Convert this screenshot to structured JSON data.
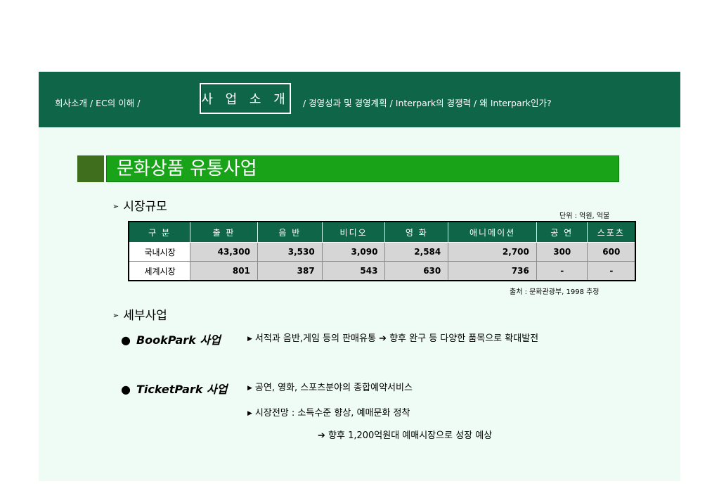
{
  "nav": {
    "left": "회사소개  /  EC의 이해  /",
    "active": "사 업 소 개",
    "right": "/ 경영성과 및  경영계획  /  Interpark의  경쟁력  /  왜 Interpark인가?"
  },
  "title": "문화상품 유통사업",
  "market": {
    "heading": "시장규모",
    "unit": "단위 : 억원, 억불",
    "source": "출처 : 문화관광부, 1998 추정",
    "headers": [
      "구  분",
      "출  판",
      "음  반",
      "비디오",
      "영  화",
      "애니메이션",
      "공  연",
      "스포츠"
    ],
    "rows": [
      {
        "label": "국내시장",
        "values": [
          "43,300",
          "3,530",
          "3,090",
          "2,584",
          "2,700",
          "300",
          "600"
        ]
      },
      {
        "label": "세계시장",
        "values": [
          "801",
          "387",
          "543",
          "630",
          "736",
          "-",
          "-"
        ]
      }
    ]
  },
  "detail": {
    "heading": "세부사업",
    "bookpark": {
      "title": "BookPark 사업",
      "desc": "서적과 음반,게임 등의 판매유통 ➔ 향후 완구 등 다양한 품목으로 확대발전"
    },
    "ticketpark": {
      "title": "TicketPark 사업",
      "desc1": "공연, 영화, 스포츠분야의 종합예약서비스",
      "desc2": "시장전망  : 소득수준 향상, 예매문화 정착",
      "desc3": "➔ 향후 1,200억원대 예매시장으로 성장 예상"
    }
  },
  "colors": {
    "header": "#0f6548",
    "title_bar": "#19a319",
    "background": "#effcf5"
  }
}
